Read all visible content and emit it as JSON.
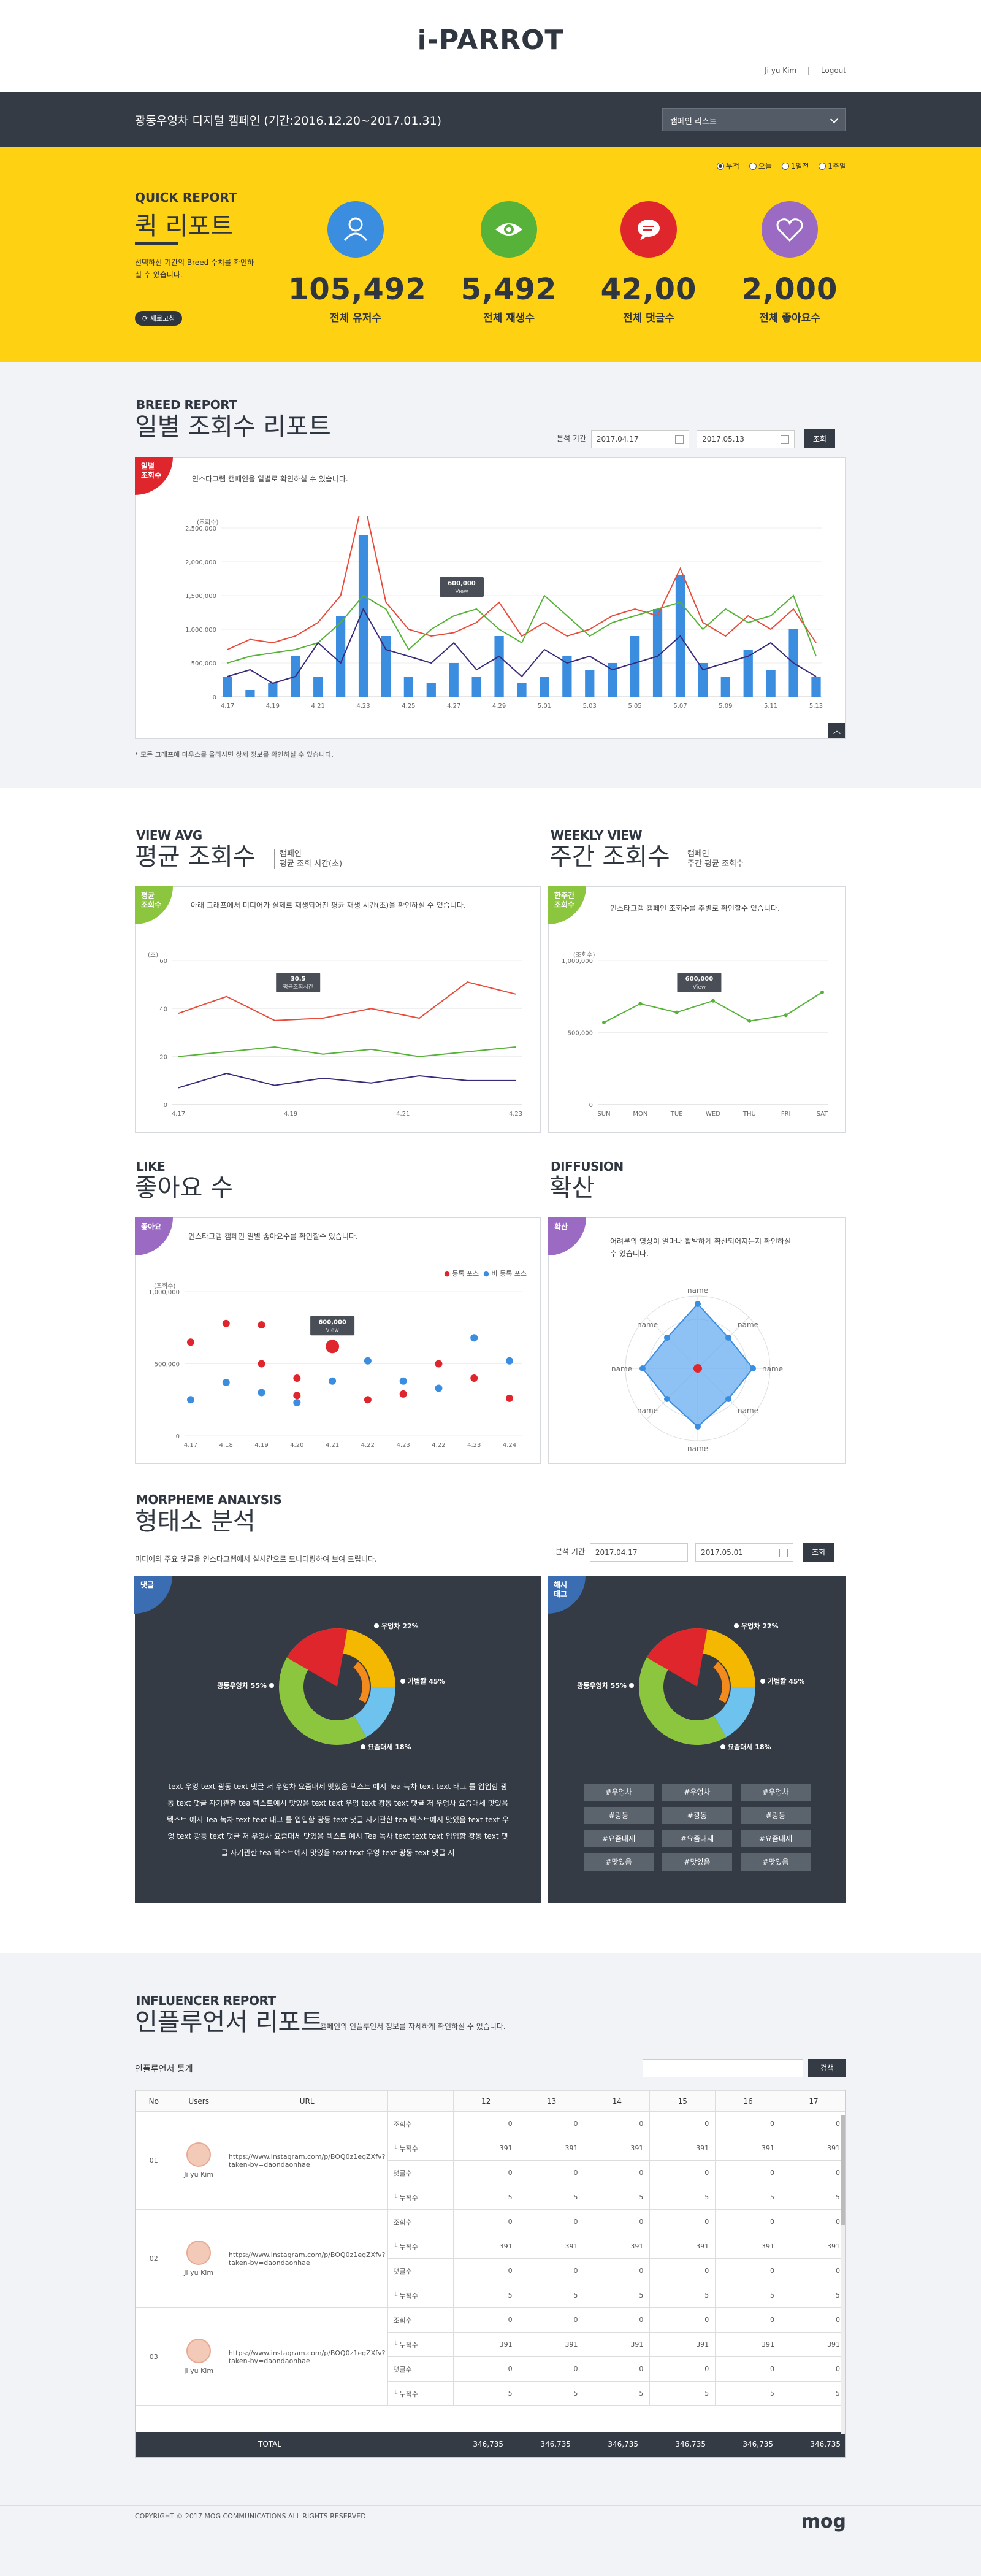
{
  "header": {
    "logo": "i-PARROT",
    "user": "Ji yu Kim",
    "logout": "Logout"
  },
  "campaign": {
    "title": "광동우엉차 디지털 캠페인 (기간:2016.12.20~2017.01.31)",
    "select": "캠페인 리스트"
  },
  "quick": {
    "title_en": "QUICK REPORT",
    "title_ko": "퀵 리포트",
    "desc": "선택하신 기간의 Breed 수치를 확인하실 수 있습니다.",
    "refresh": "새로고침",
    "radios": [
      "누적",
      "오늘",
      "1일전",
      "1주일"
    ],
    "stats": [
      {
        "value": "105,492",
        "label": "전체 유저수",
        "color": "#3b8de0",
        "icon": "user-icon"
      },
      {
        "value": "5,492",
        "label": "전체 재생수",
        "color": "#57b23a",
        "icon": "eye-icon"
      },
      {
        "value": "42,00",
        "label": "전체 댓글수",
        "color": "#e0262d",
        "icon": "comment-icon"
      },
      {
        "value": "2,000",
        "label": "전체 좋아요수",
        "color": "#9b6bc4",
        "icon": "heart-icon"
      }
    ]
  },
  "breed": {
    "title_en": "BREED REPORT",
    "title_ko": "일별 조회수 리포트",
    "period_label": "분석 기간",
    "start": "2017.04.17",
    "end": "2017.05.13",
    "search": "조회",
    "badge": "일별\n조회수",
    "desc": "인스타그램 캠페인을 일별로 확인하실 수 있습니다.",
    "note": "* 모든 그래프에 마우스를 올리시면 상세 정보를 확인하실 수 있습니다."
  },
  "avg": {
    "title_en": "VIEW AVG",
    "title_ko": "평균 조회수",
    "sub": "캠페인\n평균 조회 시간(초)",
    "badge": "평균\n조회수",
    "desc": "아래 그래프에서 미디어가 실제로 재생되어진 평균 재생 시간(초)을 확인하실 수 있습니다."
  },
  "weekly": {
    "title_en": "WEEKLY VIEW",
    "title_ko": "주간 조회수",
    "sub": "캠페인\n주간 평균 조회수",
    "badge": "한주간\n조회수",
    "desc": "인스타그램 캠페인 조회수를 주별로 확인할수 있습니다."
  },
  "like": {
    "title_en": "LIKE",
    "title_ko": "좋아요 수",
    "badge": "좋아요",
    "desc": "인스타그램 캠페인 일별 좋아요수를 확인할수 있습니다.",
    "legend": [
      "등록 포스",
      "비 등록 포스"
    ]
  },
  "diffusion": {
    "title_en": "DIFFUSION",
    "title_ko": "확산",
    "badge": "확산",
    "desc": "어려분의 영상이 얼마나 활발하게 확산되어지는지 확인하실 수 있습니다.",
    "names": [
      "name",
      "name",
      "name",
      "name",
      "name",
      "name",
      "name",
      "name"
    ]
  },
  "morph": {
    "title_en": "MORPHEME ANALYSIS",
    "title_ko": "형태소 분석",
    "desc": "미디어의 주요 댓글을 인스타그램에서 실시간으로 모니터링하여 보여 드립니다.",
    "period_label": "분석 기간",
    "start": "2017.04.17",
    "end": "2017.05.01",
    "search": "조회",
    "badge1": "댓글",
    "badge2": "해시\n태그",
    "labels": [
      "우엉차 22%",
      "가볍칼 45%",
      "요즘대세 18%",
      "광동우엉차 55%"
    ],
    "text": "text 우엉 text 광동 text 댓글 저 우엉차 요즘대세 맛있음 텍스트 예시 Tea 녹차 text text 태그 를 입입함 광동 text 댓글 자기관한 tea 텍스트예시 맛있음 text text 우엉 text 광동 text 댓글 저 우엉차 요즘대세 맛있음 텍스트 예시 Tea 녹차 text text 태그 를 입입함 광동 text 댓글 자기관한 tea 텍스트예시 맛있음 text text 우엉 text 광동 text 댓글 저 우엉차 요즘대세 맛있음 텍스트 예시 Tea 녹차 text text text 입입함 광동 text 댓글 자기관한 tea 텍스트예시 맛있음 text text 우엉 text 광동 text 댓글 저",
    "tags": [
      "#우엉차",
      "#우엉차",
      "#우엉차",
      "#광동",
      "#광동",
      "#광동",
      "#요즘대세",
      "#요즘대세",
      "#요즘대세",
      "#맛있음",
      "#맛있음",
      "#맛있음"
    ]
  },
  "influencer": {
    "title_en": "INFLUENCER REPORT",
    "title_ko": "인플루언서 리포트",
    "desc": "캠페인의 인플루언서 정보를 자세하게 확인하실 수 있습니다.",
    "stats_label": "인플루언서 통계",
    "search": "검색",
    "cols": [
      "No",
      "Users",
      "URL",
      "",
      "12",
      "13",
      "14",
      "15",
      "16",
      "17"
    ],
    "rows": [
      {
        "no": "01",
        "user": "Ji yu Kim",
        "url": "https://www.instagram.com/p/BOQ0z1egZXfv?taken-by=daondaonhae"
      },
      {
        "no": "02",
        "user": "Ji yu Kim",
        "url": "https://www.instagram.com/p/BOQ0z1egZXfv?taken-by=daondaonhae"
      },
      {
        "no": "03",
        "user": "Ji yu Kim",
        "url": "https://www.instagram.com/p/BOQ0z1egZXfv?taken-by=daondaonhae"
      }
    ],
    "metrics": [
      "조회수",
      "└ 누적수",
      "댓글수",
      "└ 누적수"
    ],
    "metric_vals": [
      "0",
      "391",
      "0",
      "5"
    ],
    "total_label": "TOTAL",
    "total": "346,735"
  },
  "footer": {
    "copy": "COPYRIGHT © 2017 MOG COMMUNICATIONS ALL RIGHTS RESERVED.",
    "logo": "mog"
  },
  "chart_data": [
    {
      "type": "line",
      "title": "일별 조회수",
      "ylabel": "(조회수)",
      "ylim": [
        0,
        2500000
      ],
      "x": [
        "4.17",
        "4.18",
        "4.19",
        "4.20",
        "4.21",
        "4.22",
        "4.23",
        "4.24",
        "4.25",
        "4.26",
        "4.27",
        "4.28",
        "4.29",
        "4.30",
        "5.01",
        "5.02",
        "5.03",
        "5.04",
        "5.05",
        "5.06",
        "5.07",
        "5.08",
        "5.09",
        "5.10",
        "5.11",
        "5.12",
        "5.13"
      ],
      "series": [
        {
          "values": [
            700000,
            850000,
            800000,
            900000,
            1100000,
            1500000,
            2950000,
            1400000,
            1000000,
            900000,
            950000,
            1100000,
            1400000,
            900000,
            1100000,
            900000,
            1000000,
            1200000,
            1300000,
            1200000,
            1900000,
            1100000,
            900000,
            1200000,
            1000000,
            1300000,
            800000
          ],
          "color": "#e74c3c"
        },
        {
          "values": [
            500000,
            600000,
            650000,
            700000,
            800000,
            1100000,
            1500000,
            1300000,
            700000,
            1000000,
            1200000,
            1300000,
            1000000,
            800000,
            1500000,
            1200000,
            900000,
            1100000,
            1200000,
            1300000,
            1400000,
            1000000,
            1300000,
            1100000,
            1200000,
            1500000,
            600000
          ],
          "color": "#57b23a"
        },
        {
          "values": [
            300000,
            400000,
            200000,
            300000,
            800000,
            500000,
            1300000,
            700000,
            600000,
            500000,
            800000,
            400000,
            600000,
            300000,
            700000,
            500000,
            600000,
            400000,
            500000,
            600000,
            900000,
            400000,
            500000,
            600000,
            800000,
            500000,
            300000
          ],
          "color": "#3a2a7a"
        }
      ],
      "bars": [
        300000,
        100000,
        200000,
        600000,
        300000,
        1200000,
        2400000,
        900000,
        300000,
        200000,
        500000,
        300000,
        900000,
        200000,
        300000,
        600000,
        400000,
        500000,
        900000,
        1300000,
        1800000,
        500000,
        300000,
        700000,
        400000,
        1000000,
        300000
      ],
      "tooltip": {
        "value": "600,000",
        "label": "View"
      }
    },
    {
      "type": "line",
      "title": "평균 조회수",
      "ylabel": "(초)",
      "ylim": [
        0,
        60
      ],
      "x": [
        "4.17",
        "4.19",
        "4.21",
        "4.23"
      ],
      "series": [
        {
          "values": [
            38,
            45,
            35,
            36,
            40,
            36,
            51,
            46
          ],
          "color": "#e74c3c"
        },
        {
          "values": [
            20,
            22,
            24,
            21,
            23,
            20,
            22,
            24
          ],
          "color": "#57b23a"
        },
        {
          "values": [
            7,
            13,
            8,
            11,
            9,
            12,
            10,
            10
          ],
          "color": "#3a2a7a"
        }
      ],
      "tooltip": {
        "value": "30.5",
        "label": "평균조회시간"
      }
    },
    {
      "type": "line",
      "title": "주간 조회수",
      "ylabel": "(조회수)",
      "ylim": [
        0,
        1000000
      ],
      "x": [
        "SUN",
        "MON",
        "TUE",
        "WED",
        "THU",
        "FRI",
        "SAT"
      ],
      "series": [
        {
          "values": [
            570000,
            700000,
            640000,
            720000,
            580000,
            620000,
            780000
          ],
          "color": "#57b23a"
        }
      ],
      "tooltip": {
        "value": "600,000",
        "label": "View"
      }
    },
    {
      "type": "scatter",
      "title": "좋아요 수",
      "ylabel": "(조회수)",
      "ylim": [
        0,
        1000000
      ],
      "x": [
        "4.17",
        "4.18",
        "4.19",
        "4.20",
        "4.21",
        "4.22",
        "4.23",
        "4.22",
        "4.23",
        "4.24"
      ],
      "series": [
        {
          "name": "등록 포스",
          "values": [
            [
              0,
              650000
            ],
            [
              1,
              780000
            ],
            [
              2,
              500000
            ],
            [
              2,
              770000
            ],
            [
              3,
              400000
            ],
            [
              3,
              280000
            ],
            [
              4,
              620000
            ],
            [
              5,
              250000
            ],
            [
              6,
              290000
            ],
            [
              7,
              500000
            ],
            [
              8,
              400000
            ],
            [
              9,
              260000
            ]
          ],
          "color": "#e0262d"
        },
        {
          "name": "비 등록 포스",
          "values": [
            [
              0,
              250000
            ],
            [
              1,
              370000
            ],
            [
              2,
              300000
            ],
            [
              3,
              230000
            ],
            [
              4,
              380000
            ],
            [
              5,
              520000
            ],
            [
              6,
              380000
            ],
            [
              7,
              330000
            ],
            [
              8,
              680000
            ],
            [
              9,
              520000
            ]
          ],
          "color": "#3b8de0"
        }
      ],
      "tooltip": {
        "value": "600,000",
        "label": "View"
      }
    },
    {
      "type": "pie",
      "title": "댓글",
      "values": [
        22,
        45,
        18,
        55
      ],
      "labels": [
        "우엉차",
        "가볍칼",
        "요즘대세",
        "광동우엉차"
      ]
    },
    {
      "type": "pie",
      "title": "해시태그",
      "values": [
        22,
        45,
        18,
        55
      ],
      "labels": [
        "우엉차",
        "가볍칼",
        "요즘대세",
        "광동우엉차"
      ]
    }
  ]
}
